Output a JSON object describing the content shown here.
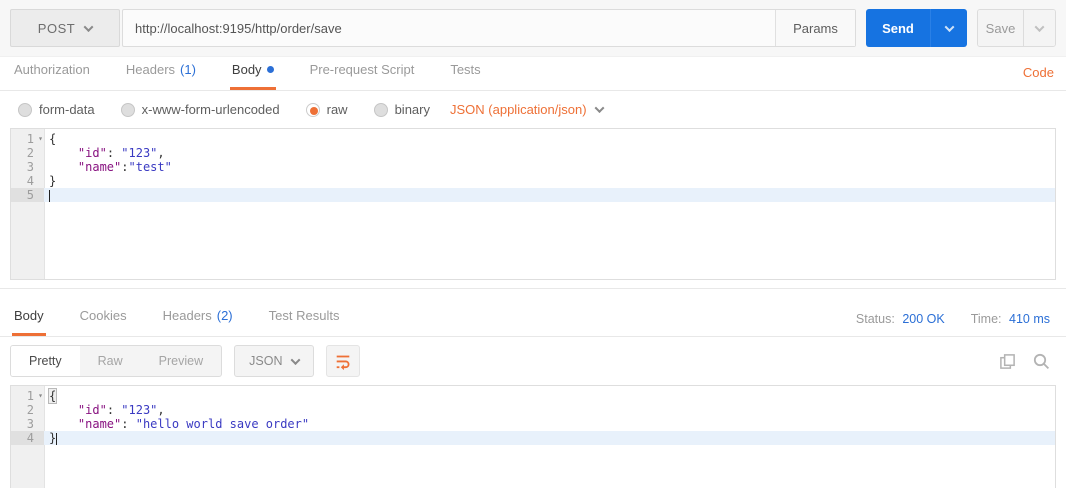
{
  "colors": {
    "accent_orange": "#ee7036",
    "primary_blue": "#1673e1",
    "link_blue": "#2b6fd6",
    "json_key_color": "#881280",
    "json_string_color": "#3a3ac2"
  },
  "request_bar": {
    "method": "POST",
    "url": "http://localhost:9195/http/order/save",
    "params_button": "Params",
    "send_button": "Send",
    "save_button": "Save"
  },
  "request_tabs": {
    "authorization": "Authorization",
    "headers": "Headers",
    "headers_count": "(1)",
    "body": "Body",
    "pre_request": "Pre-request Script",
    "tests": "Tests",
    "code_link": "Code"
  },
  "body_options": {
    "form_data": "form-data",
    "x_www_form_urlencoded": "x-www-form-urlencoded",
    "raw": "raw",
    "binary": "binary",
    "selected_type": "JSON (application/json)"
  },
  "request_editor": {
    "lines": [
      {
        "num": "1",
        "fold": true,
        "tokens": [
          {
            "text": "{",
            "type": "plain"
          }
        ]
      },
      {
        "num": "2",
        "tokens": [
          {
            "text": "    ",
            "type": "plain"
          },
          {
            "text": "\"id\"",
            "type": "key"
          },
          {
            "text": ": ",
            "type": "plain"
          },
          {
            "text": "\"123\"",
            "type": "string"
          },
          {
            "text": ",",
            "type": "plain"
          }
        ]
      },
      {
        "num": "3",
        "tokens": [
          {
            "text": "    ",
            "type": "plain"
          },
          {
            "text": "\"name\"",
            "type": "key"
          },
          {
            "text": ":",
            "type": "plain"
          },
          {
            "text": "\"test\"",
            "type": "string"
          }
        ]
      },
      {
        "num": "4",
        "tokens": [
          {
            "text": "}",
            "type": "plain"
          }
        ]
      },
      {
        "num": "5",
        "active": true,
        "cursor": true,
        "tokens": []
      }
    ]
  },
  "response_tabs": {
    "body": "Body",
    "cookies": "Cookies",
    "headers": "Headers",
    "headers_count": "(2)",
    "test_results": "Test Results",
    "status_label": "Status:",
    "status_value": "200 OK",
    "time_label": "Time:",
    "time_value": "410 ms"
  },
  "response_toolbar": {
    "pretty": "Pretty",
    "raw": "Raw",
    "preview": "Preview",
    "format": "JSON"
  },
  "response_editor": {
    "lines": [
      {
        "num": "1",
        "fold": true,
        "tokens": [
          {
            "text": "{",
            "type": "bracket"
          }
        ]
      },
      {
        "num": "2",
        "tokens": [
          {
            "text": "    ",
            "type": "plain"
          },
          {
            "text": "\"id\"",
            "type": "key"
          },
          {
            "text": ": ",
            "type": "plain"
          },
          {
            "text": "\"123\"",
            "type": "string"
          },
          {
            "text": ",",
            "type": "plain"
          }
        ]
      },
      {
        "num": "3",
        "tokens": [
          {
            "text": "    ",
            "type": "plain"
          },
          {
            "text": "\"name\"",
            "type": "key"
          },
          {
            "text": ": ",
            "type": "plain"
          },
          {
            "text": "\"hello world save order\"",
            "type": "string"
          }
        ]
      },
      {
        "num": "4",
        "active": true,
        "cursor": true,
        "tokens": [
          {
            "text": "}",
            "type": "plain"
          }
        ]
      }
    ]
  }
}
